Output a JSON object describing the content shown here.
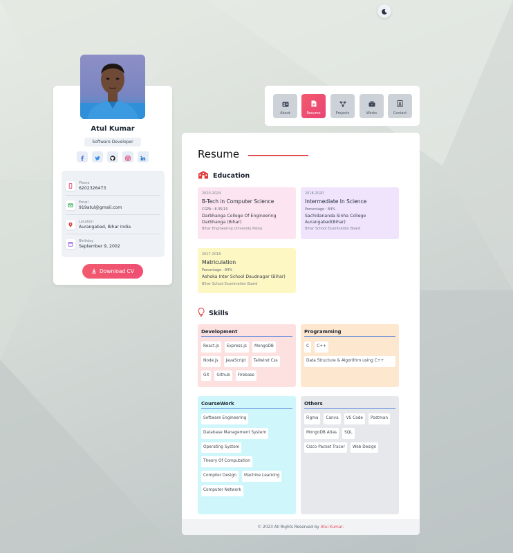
{
  "profile": {
    "name": "Atul Kumar",
    "role": "Software Developer",
    "socials": [
      "facebook-icon",
      "twitter-icon",
      "github-icon",
      "instagram-icon",
      "linkedin-icon"
    ],
    "contacts": [
      {
        "label": "Phone",
        "value": "6202326473",
        "icon": "phone-icon"
      },
      {
        "label": "Email",
        "value": "919atul@gmail.com",
        "icon": "email-icon"
      },
      {
        "label": "Location",
        "value": "Aurangabad, Bihar India",
        "icon": "location-icon"
      },
      {
        "label": "Birthday",
        "value": "September 9, 2002",
        "icon": "calendar-icon"
      }
    ],
    "download_label": "Download CV"
  },
  "nav": {
    "items": [
      {
        "label": "About",
        "icon": "id-card-icon"
      },
      {
        "label": "Resume",
        "icon": "document-icon"
      },
      {
        "label": "Projects",
        "icon": "projects-icon"
      },
      {
        "label": "Works",
        "icon": "briefcase-icon"
      },
      {
        "label": "Contact",
        "icon": "contact-icon"
      }
    ],
    "active": "Resume"
  },
  "resume": {
    "title": "Resume",
    "education_heading": "Education",
    "education": [
      {
        "years": "2020-2024",
        "title": "B-Tech in Computer Science",
        "grade": "CGPA : 8.35/10",
        "institute": "Darbhanga College Of Engineering Darbhanga (Bihar)",
        "board": "Bihar Engineering University Patna"
      },
      {
        "years": "2018-2020",
        "title": "Intermediate In Science",
        "grade": "Percentage : 84%",
        "institute": "Sachidananda Sinha College Aurangabad(Bihar)",
        "board": "Bihar School Examination Board"
      },
      {
        "years": "2017-2018",
        "title": "Matriculation",
        "grade": "Percentage : 84%",
        "institute": "Ashoka Inter School Daudnagar (Bihar)",
        "board": "Bihar School Examination Board"
      }
    ],
    "skills_heading": "Skills",
    "skills": {
      "development": {
        "title": "Development",
        "items": [
          "React.js",
          "Express.js",
          "MongoDB",
          "Node.js",
          "JavaScript",
          "Tailwind Css",
          "Git",
          "Github",
          "Firebase"
        ]
      },
      "programming": {
        "title": "Programming",
        "items": [
          "C",
          "C++",
          "Data Structure & Algorithm using C++"
        ]
      },
      "coursework": {
        "title": "CourseWork",
        "items": [
          "Software Engineering",
          "Database Management System",
          "Operating System",
          "Theory Of Computation",
          "Compiler Design",
          "Machine Learning",
          "Computer Network"
        ]
      },
      "others": {
        "title": "Others",
        "items": [
          "Figma",
          "Canva",
          "VS Code",
          "Postman",
          "MongoDB Atlas",
          "SQL",
          "Cisco Packet Tracer",
          "Web Design"
        ]
      }
    }
  },
  "footer": {
    "text": "© 2023 All Rights Reserved by",
    "author": "Atul Kumar",
    "suffix": "."
  },
  "colors": {
    "accent": "#ef4f73",
    "edu1": "#fce4f0",
    "edu2": "#efe4fc",
    "edu3": "#fdf7c4",
    "dev": "#fde1e1",
    "prog": "#fde7cf",
    "course": "#cff7fb",
    "others": "#e6e8ec"
  }
}
